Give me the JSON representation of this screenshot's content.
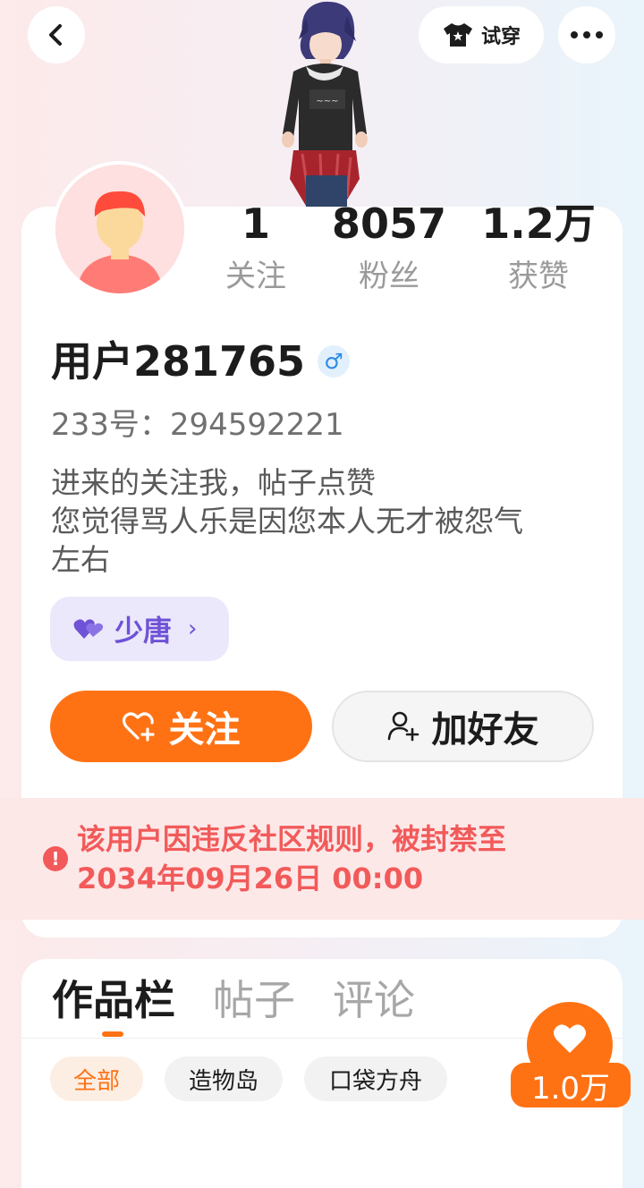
{
  "top_bar": {
    "back_icon": "chevron-left-icon",
    "tryon_label": "试穿",
    "tryon_icon": "tshirt-icon",
    "more_icon": "ellipsis-icon"
  },
  "profile": {
    "stats": [
      {
        "value": "1",
        "label": "关注"
      },
      {
        "value": "8057",
        "label": "粉丝"
      },
      {
        "value": "1.2万",
        "label": "获赞"
      }
    ],
    "username": "用户281765",
    "gender_symbol": "♂",
    "user_id": "233号：294592221",
    "bio_lines": [
      "进来的关注我，帖子点赞",
      "您觉得骂人乐是因您本人无才被怨气",
      "左右"
    ],
    "guild": {
      "name": "少唐",
      "arrow": "›"
    },
    "follow_label": "关注",
    "add_friend_label": "加好友"
  },
  "ban_notice": {
    "icon": "!",
    "line1": "该用户因违反社区规则，被封禁至",
    "line2": "2034年09月26日 00:00"
  },
  "works": {
    "tabs": [
      "作品栏",
      "帖子",
      "评论"
    ],
    "active_tab": 0,
    "chips": [
      "全部",
      "造物岛",
      "口袋方舟"
    ],
    "active_chip": 0
  },
  "like_fab": {
    "count": "1.0万"
  },
  "colors": {
    "accent": "#ff7214",
    "ban_text": "#f25a5a",
    "guild": "#6f52d6"
  }
}
